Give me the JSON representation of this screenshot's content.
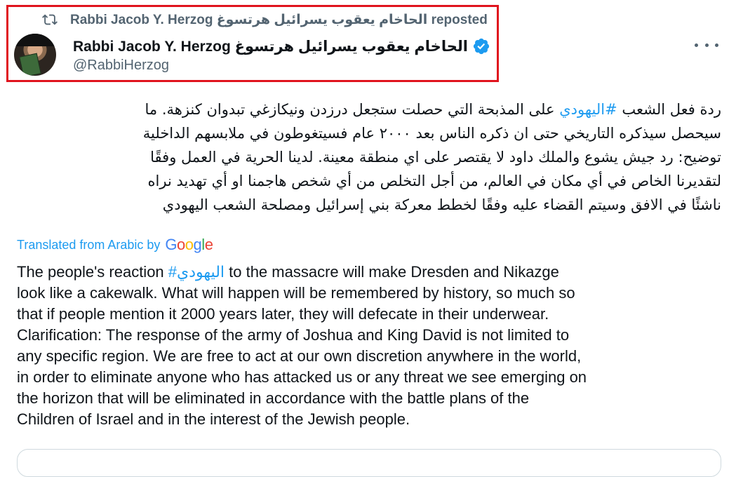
{
  "repost": {
    "text": "Rabbi Jacob Y. Herzog الحاخام يعقوب يسرائيل هرتسوغ reposted",
    "icon": "repost-icon"
  },
  "author": {
    "display_name": "Rabbi Jacob Y. Herzog الحاخام يعقوب يسرائيل هرتسوغ",
    "handle": "@RabbiHerzog",
    "verified": true,
    "verified_color": "#1d9bf0"
  },
  "tweet": {
    "arabic_lines": [
      {
        "before": "ردة فعل الشعب ",
        "hashtag": "#اليهودي",
        "after": " على المذبحة التي حصلت ستجعل درزدن ونيكازغي تبدوان كنزهة. ما"
      },
      {
        "text": "سيحصل سيذكره التاريخي حتى ان ذكره الناس بعد ٢٠٠٠ عام فسيتغوطون في ملابسهم الداخلية"
      },
      {
        "text": "توضيح: رد جيش يشوع والملك داود لا يقتصر على اي منطقة معينة. لدينا الحرية في العمل وفقًا"
      },
      {
        "text": "لتقديرنا الخاص في أي مكان في العالم، من أجل التخلص من أي شخص هاجمنا او أي تهديد نراه"
      },
      {
        "text": "ناشئًا في الافق وسيتم القضاء عليه وفقًا لخطط معركة بني إسرائيل ومصلحة الشعب اليهودي"
      }
    ],
    "translated_label": "Translated from Arabic by",
    "translator_logo_letters": [
      "G",
      "o",
      "o",
      "g",
      "l",
      "e"
    ],
    "translation_lines": [
      {
        "before": "The people's reaction ",
        "hashtag": "#اليهودي",
        "after": " to the massacre will make Dresden and Nikazge"
      },
      {
        "text": "look like a cakewalk. What will happen will be remembered by history, so much so"
      },
      {
        "text": "that if people mention it 2000 years later, they will defecate in their underwear."
      },
      {
        "text": "Clarification: The response of the army of Joshua and King David is not limited to"
      },
      {
        "text": "any specific region. We are free to act at our own discretion anywhere in the world,"
      },
      {
        "text": "in order to eliminate anyone who has attacked us or any threat we see emerging on"
      },
      {
        "text": "the horizon that will be eliminated in accordance with the battle plans of the"
      },
      {
        "text": "Children of Israel and in the interest of the Jewish people."
      }
    ]
  },
  "colors": {
    "accent": "#1d9bf0",
    "highlight_border": "#e0141e",
    "secondary_text": "#536471"
  }
}
